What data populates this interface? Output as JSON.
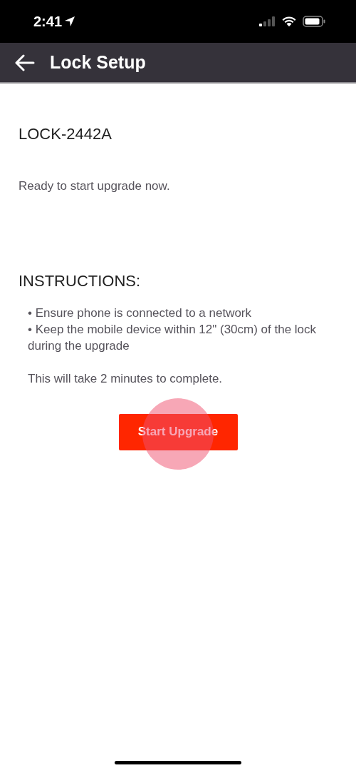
{
  "status_bar": {
    "time": "2:41"
  },
  "header": {
    "title": "Lock Setup"
  },
  "device_name": "LOCK-2442A",
  "status_message": "Ready to start upgrade now.",
  "instructions": {
    "heading": "INSTRUCTIONS:",
    "items": [
      "• Ensure phone is connected to a network",
      "• Keep the mobile device within 12\" (30cm) of the lock during the upgrade"
    ],
    "note": "This will take 2 minutes to complete."
  },
  "button": {
    "label": "Start Upgrade",
    "touched": true
  }
}
